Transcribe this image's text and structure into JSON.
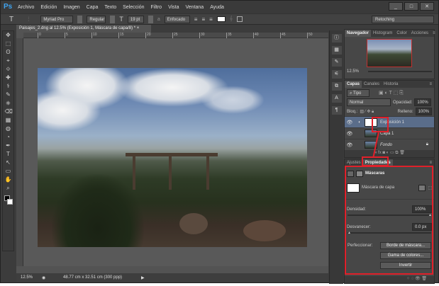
{
  "app": {
    "logo": "Ps",
    "menu": [
      "Archivo",
      "Edición",
      "Imagen",
      "Capa",
      "Texto",
      "Selección",
      "Filtro",
      "Vista",
      "Ventana",
      "Ayuda"
    ],
    "window_buttons": [
      "_",
      "□",
      "✕"
    ]
  },
  "options": {
    "tool_icon": "T",
    "font": "Myriad Pro",
    "style": "Regular",
    "size": "19 pt",
    "antialias": "Enfocado",
    "workspace": "Retoching"
  },
  "document": {
    "tab_title": "Paisajes_2.dng al 12.5% (Exposición 1, Máscara de capa/8) *",
    "close": "×",
    "ruler_ticks": [
      "0",
      "5",
      "10",
      "15",
      "20",
      "25",
      "30",
      "35",
      "40",
      "45",
      "50"
    ],
    "zoom": "12.5%",
    "doc_size": "48.77 cm x 32.51 cm (300 ppp)"
  },
  "navigator": {
    "tabs": [
      "Navegador",
      "Histogram",
      "Color",
      "Acciones"
    ],
    "zoom": "12.5%"
  },
  "layers": {
    "tabs": [
      "Capas",
      "Canales",
      "Historia"
    ],
    "filter": "Tipo",
    "blend": "Normal",
    "opacity_label": "Opacidad:",
    "opacity": "100%",
    "lock_label": "Bloq.:",
    "fill_label": "Relleno:",
    "fill": "100%",
    "items": [
      {
        "name": "Exposición 1",
        "selected": true
      },
      {
        "name": "Capa 1",
        "selected": false
      },
      {
        "name": "Fondo",
        "selected": false
      }
    ]
  },
  "properties": {
    "tabs": [
      "Ajustes",
      "Propiedades"
    ],
    "section": "Máscaras",
    "mask_label": "Máscara de capa",
    "density_label": "Densidad:",
    "density": "100%",
    "density_pct": 100,
    "feather_label": "Desvanecer:",
    "feather": "0.0 px",
    "feather_pct": 0,
    "refine_label": "Perfeccionar:",
    "buttons": [
      "Borde de máscara...",
      "Gama de colores...",
      "Invertir"
    ]
  },
  "colors": {
    "highlight": "#e0202a",
    "selected_layer": "#5a6d8a"
  }
}
